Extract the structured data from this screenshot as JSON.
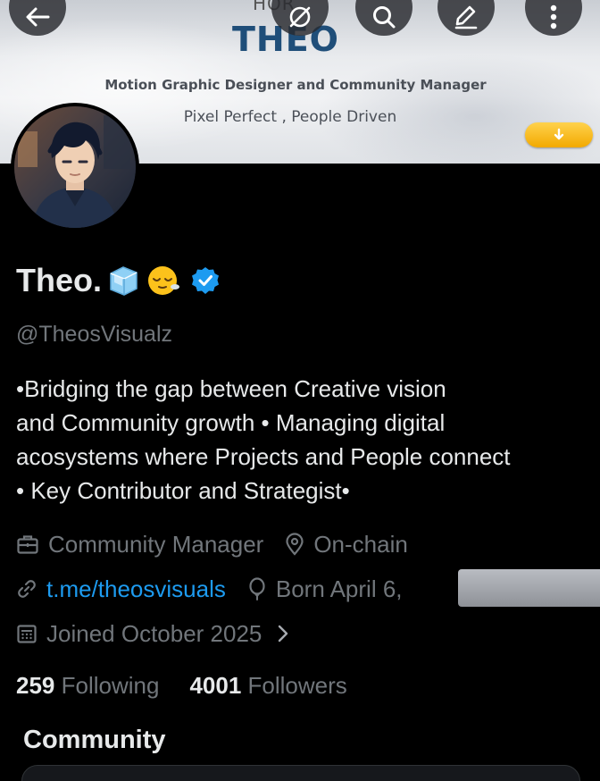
{
  "banner": {
    "logo_top_text": "HOR",
    "title": "THEO",
    "tagline": "Motion Graphic Designer and Community Manager",
    "slogan": "Pixel Perfect , People Driven"
  },
  "profile": {
    "display_name": "Theo.",
    "name_emojis": [
      "ice-cube-emoji",
      "face-exhaling-emoji"
    ],
    "verified": true,
    "handle": "@TheosVisualz",
    "bio_lines": [
      "•Bridging the gap between Creative vision",
      "and Community growth • Managing digital",
      "acosystems where Projects and People connect",
      "• Key Contributor and Strategist•"
    ],
    "profession": "Community Manager",
    "location": "On-chain",
    "website": "t.me/theosvisuals",
    "birthday": "Born April 6,",
    "joined": "Joined October 2025",
    "following_count": "259",
    "following_label": "Following",
    "followers_count": "4001",
    "followers_label": "Followers"
  },
  "community": {
    "title": "Community"
  },
  "colors": {
    "background": "#000000",
    "text_primary": "#e7e9ea",
    "text_secondary": "#71767b",
    "link": "#1d9bf0",
    "verified": "#1d9bf0",
    "banner_title": "#1f4e79",
    "download_badge": "#f2a900"
  },
  "icons": {
    "nav": [
      "back-arrow-icon",
      "grok-icon",
      "search-icon",
      "edit-icon",
      "more-icon"
    ],
    "meta": [
      "briefcase-icon",
      "location-pin-icon",
      "link-icon",
      "balloon-icon",
      "calendar-icon",
      "chevron-right-icon"
    ]
  }
}
